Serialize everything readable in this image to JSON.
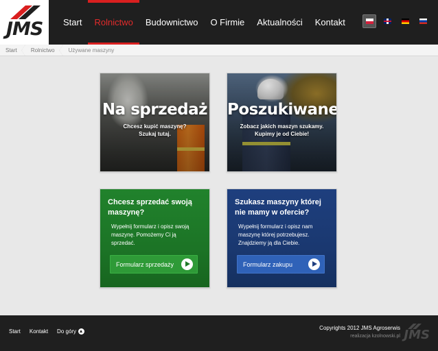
{
  "logo": {
    "text": "JMS"
  },
  "nav": {
    "items": [
      {
        "label": "Start"
      },
      {
        "label": "Rolnictwo",
        "active": true
      },
      {
        "label": "Budownictwo"
      },
      {
        "label": "O Firmie"
      },
      {
        "label": "Aktualności"
      },
      {
        "label": "Kontakt"
      }
    ]
  },
  "languages": [
    {
      "code": "pl",
      "icon": "flag-pl-icon",
      "active": true
    },
    {
      "code": "en",
      "icon": "flag-en-icon"
    },
    {
      "code": "de",
      "icon": "flag-de-icon"
    },
    {
      "code": "ru",
      "icon": "flag-ru-icon"
    }
  ],
  "breadcrumb": [
    "Start",
    "Rolnictwo",
    "Używane maszyny"
  ],
  "tiles": {
    "sell": {
      "title": "Na sprzedaż",
      "line1": "Chcesz kupić maszynę?",
      "line2": "Szukaj tutaj."
    },
    "wanted": {
      "title": "Poszukiwane",
      "line1": "Zobacz jakich maszyn szukamy.",
      "line2": "Kupimy je od Ciebie!"
    }
  },
  "boxes": {
    "sell": {
      "heading": "Chcesz sprzedać swoją maszynę?",
      "text": "Wypełnij formularz i opisz swoją maszynę. Pomożemy Ci ją sprzedać.",
      "button": "Formularz sprzedaży",
      "color": "#1f7a28"
    },
    "buy": {
      "heading": "Szukasz maszyny której nie mamy w ofercie?",
      "text": "Wypełnij formularz i opisz nam maszynę której potrzebujesz. Znajdziemy ją dla Ciebie.",
      "button": "Formularz zakupu",
      "color": "#1e3f7e"
    }
  },
  "footer": {
    "nav": [
      "Start",
      "Kontakt",
      "Do góry"
    ],
    "copyright": "Copyrights 2012 JMS Agroserwis",
    "credit": "realizacja kzolnowski.pl",
    "logo": "JMS"
  },
  "colors": {
    "accent": "#d91f1f",
    "header_bg": "#1f1f1f"
  }
}
